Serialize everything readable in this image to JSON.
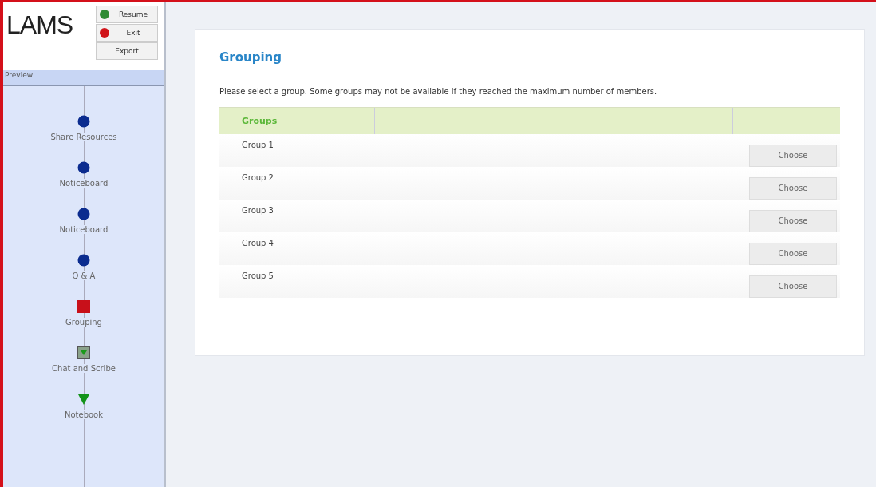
{
  "logo": "LAMS",
  "controls": [
    {
      "label": "Resume",
      "kind": "go"
    },
    {
      "label": "Exit",
      "kind": "stop"
    },
    {
      "label": "Export",
      "kind": "plain"
    }
  ],
  "sidebar": {
    "title": "Preview",
    "items": [
      {
        "label": "Share Resources",
        "kind": "circle"
      },
      {
        "label": "Noticeboard",
        "kind": "circle"
      },
      {
        "label": "Noticeboard",
        "kind": "circle"
      },
      {
        "label": "Q & A",
        "kind": "circle"
      },
      {
        "label": "Grouping",
        "kind": "square"
      },
      {
        "label": "Chat and Scribe",
        "kind": "boxed"
      },
      {
        "label": "Notebook",
        "kind": "triangle"
      }
    ]
  },
  "content": {
    "title": "Grouping",
    "instructions": "Please select a group. Some groups may not be available if they reached the maximum number of members.",
    "table": {
      "columns": [
        "Groups"
      ],
      "rows": [
        {
          "name": "Group 1",
          "action": "Choose"
        },
        {
          "name": "Group 2",
          "action": "Choose"
        },
        {
          "name": "Group 3",
          "action": "Choose"
        },
        {
          "name": "Group 4",
          "action": "Choose"
        },
        {
          "name": "Group 5",
          "action": "Choose"
        }
      ]
    }
  }
}
